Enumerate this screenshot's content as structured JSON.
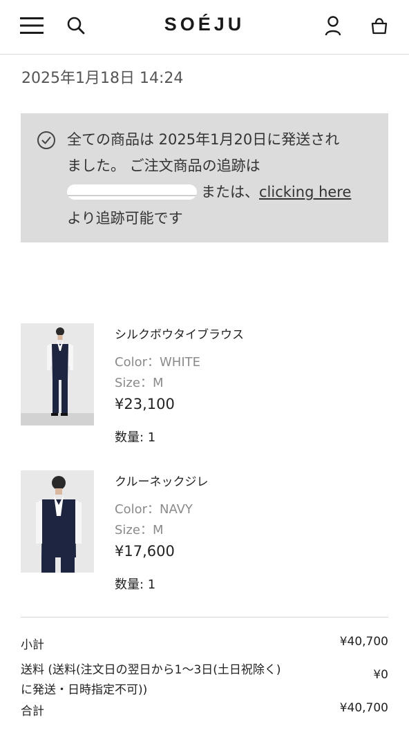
{
  "header": {
    "logo": "SOÉJU",
    "icons": [
      "menu-icon",
      "search-icon",
      "account-icon",
      "cart-icon"
    ]
  },
  "order": {
    "datetime": "2025年1月18日 14:24"
  },
  "notice": {
    "line1": "全ての商品は 2025年1月20日に発送され",
    "line2": "ました。 ご注文商品の追跡は",
    "line3_after_redaction": "または、",
    "link": "clicking here",
    "line4": "より追跡可能です"
  },
  "items": [
    {
      "name": "シルクボウタイブラウス",
      "color": "Color：WHITE",
      "size": "Size：M",
      "price": "¥23,100",
      "qty": "数量: 1"
    },
    {
      "name": "クルーネックジレ",
      "color": "Color：NAVY",
      "size": "Size：M",
      "price": "¥17,600",
      "qty": "数量: 1"
    }
  ],
  "summary": {
    "subtotal_label": "小計",
    "subtotal": "¥40,700",
    "shipping_label_1": "送料 (送料(注文日の翌日から1〜3日(土日祝除く)",
    "shipping_label_2": "に発送・日時指定不可))",
    "shipping": "¥0",
    "total_label": "合計",
    "total": "¥40,700"
  },
  "colors": {
    "notice_bg": "#dcdcdc",
    "text": "#222222",
    "muted": "#8a8a8a",
    "navy": "#1c2340"
  }
}
